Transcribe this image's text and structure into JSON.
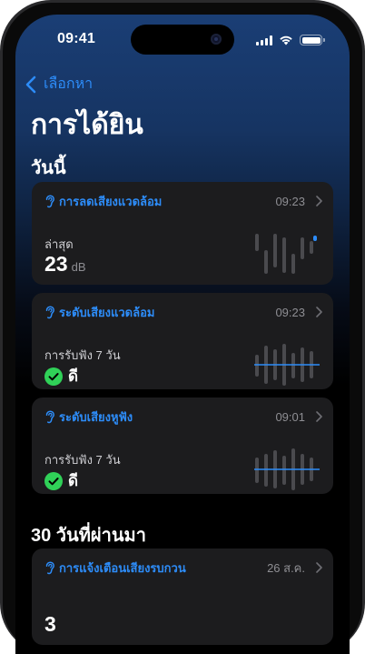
{
  "status_bar": {
    "time": "09:41"
  },
  "nav": {
    "back_label": "เลือกหา"
  },
  "page": {
    "title": "การได้ยิน"
  },
  "sections": {
    "today": "วันนี้",
    "last30": "30 วันที่ผ่านมา"
  },
  "cards": {
    "noise_reduction": {
      "title": "การลดเสียงแวดล้อม",
      "time": "09:23",
      "label": "ล่าสุด",
      "value": "23",
      "unit": "dB"
    },
    "environmental": {
      "title": "ระดับเสียงแวดล้อม",
      "time": "09:23",
      "label": "การรับฟัง 7 วัน",
      "status": "ดี"
    },
    "headphone": {
      "title": "ระดับเสียงหูฟัง",
      "time": "09:01",
      "label": "การรับฟัง 7 วัน",
      "status": "ดี"
    },
    "notifications": {
      "title": "การแจ้งเตือนเสียงรบกวน",
      "date": "26 ส.ค.",
      "value": "3"
    }
  },
  "colors": {
    "accent": "#2d8cf8",
    "ok_green": "#30d158",
    "card_bg": "#1c1c1e"
  },
  "icons": {
    "back": "chevron-left-icon",
    "ear": "ear-icon",
    "disclosure": "chevron-right-icon",
    "ok": "checkmark-circle-icon"
  }
}
